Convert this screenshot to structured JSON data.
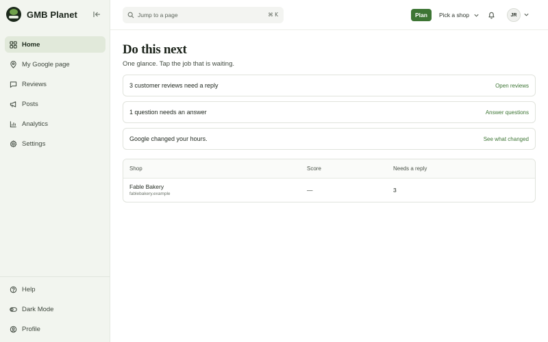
{
  "brand": {
    "name": "GMB Planet"
  },
  "sidebar": {
    "items": [
      {
        "label": "Home",
        "icon": "grid-icon",
        "active": true
      },
      {
        "label": "My Google page",
        "icon": "map-pin-icon"
      },
      {
        "label": "Reviews",
        "icon": "message-square-icon"
      },
      {
        "label": "Posts",
        "icon": "megaphone-icon"
      },
      {
        "label": "Analytics",
        "icon": "bar-chart-icon"
      },
      {
        "label": "Settings",
        "icon": "gear-icon"
      }
    ],
    "bottom_items": [
      {
        "label": "Help",
        "icon": "help-circle-icon"
      },
      {
        "label": "Dark Mode",
        "icon": "toggle-icon"
      },
      {
        "label": "Profile",
        "icon": "user-icon"
      }
    ]
  },
  "topbar": {
    "search_placeholder": "Jump to a page",
    "search_shortcut": "⌘ K",
    "plan_label": "Plan",
    "shop_picker_label": "Pick a shop",
    "avatar_initials": "JR"
  },
  "main": {
    "title": "Do this next",
    "subtitle": "One glance. Tap the job that is waiting.",
    "tasks": [
      {
        "text": "3 customer reviews need a reply",
        "action": "Open reviews"
      },
      {
        "text": "1 question needs an answer",
        "action": "Answer questions"
      },
      {
        "text": "Google changed your hours.",
        "action": "See what changed"
      }
    ],
    "table": {
      "columns": [
        "Shop",
        "Score",
        "Needs a reply"
      ],
      "rows": [
        {
          "shop": "Fable Bakery",
          "domain": "fablebakery.example",
          "score": "—",
          "needs_reply": "3"
        }
      ]
    }
  },
  "colors": {
    "accent": "#3d7534",
    "sidebar_bg": "#f2f5ef",
    "active_item_bg": "#e1e9da"
  }
}
